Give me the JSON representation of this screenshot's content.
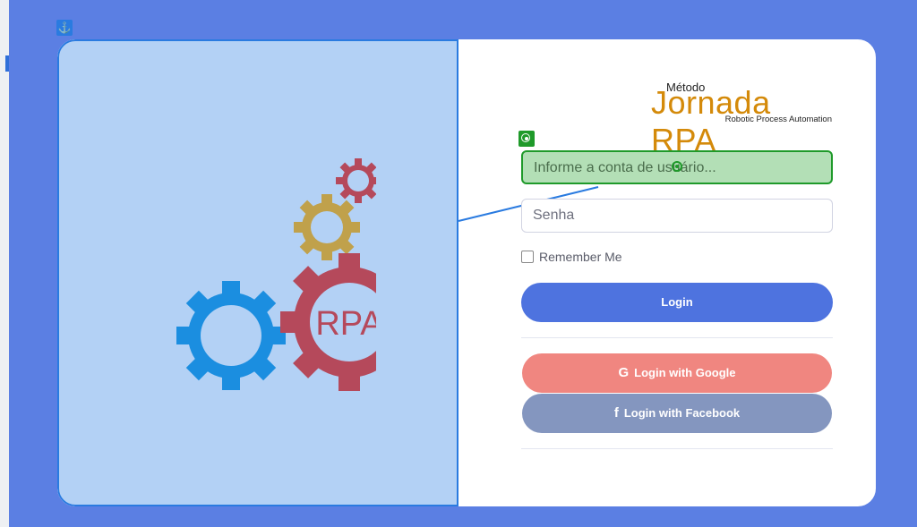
{
  "logo": {
    "small": "Método",
    "big": "Jornada RPA",
    "sub": "Robotic Process Automation"
  },
  "illustration": {
    "gear_label": "RPA"
  },
  "form": {
    "username_placeholder": "Informe a conta de usuário...",
    "password_placeholder": "Senha",
    "remember_label": "Remember Me",
    "login_label": "Login",
    "google_label": "Login with Google",
    "facebook_label": "Login with Facebook",
    "google_glyph": "G",
    "facebook_glyph": "f"
  },
  "icons": {
    "anchor": "⚓"
  },
  "colors": {
    "background": "#5b7fe3",
    "login": "#4e73df",
    "google": "#f08680",
    "facebook": "#8496bf",
    "logo": "#d48a0a",
    "selection_blue": "#2a7be0",
    "selection_green": "#1f9a2a"
  }
}
